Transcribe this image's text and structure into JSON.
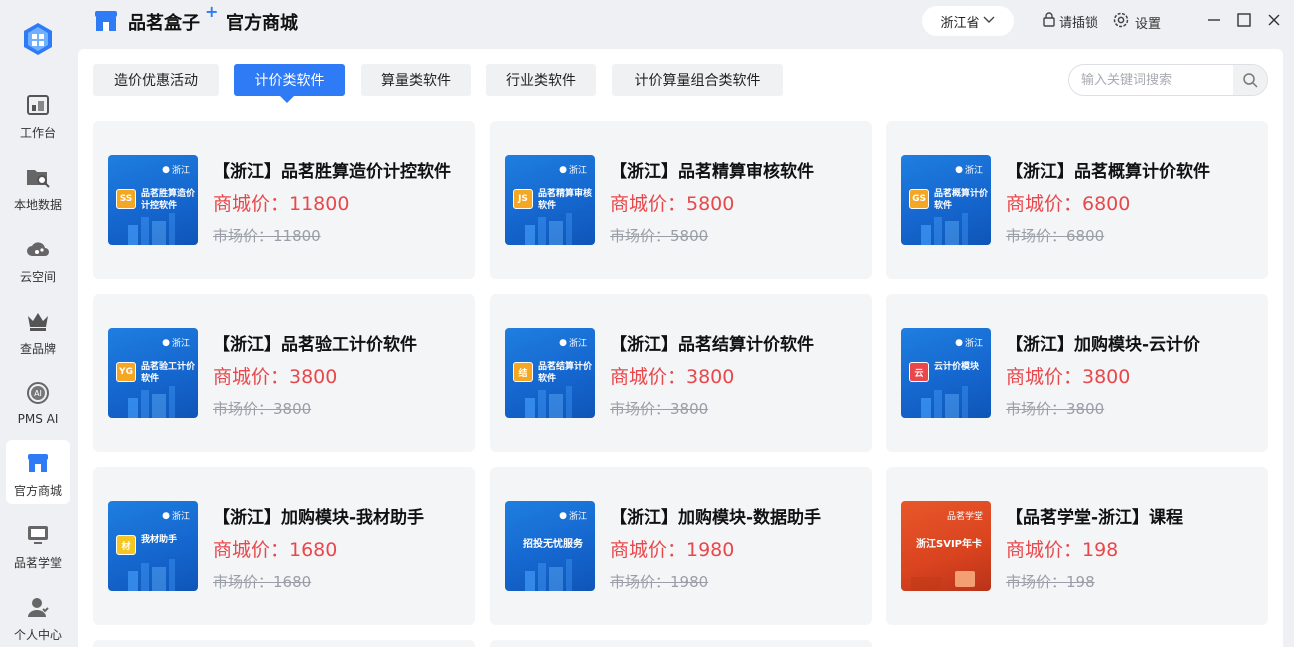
{
  "app": {
    "name": "品茗盒子",
    "plus": "+",
    "subtitle": "官方商城"
  },
  "header": {
    "province": "浙江省",
    "lock_label": "请插锁",
    "settings_label": "设置"
  },
  "sidebar": {
    "items": [
      {
        "label": "工作台"
      },
      {
        "label": "本地数据"
      },
      {
        "label": "云空间"
      },
      {
        "label": "查品牌"
      },
      {
        "label": "PMS AI"
      },
      {
        "label": "官方商城"
      },
      {
        "label": "品茗学堂"
      },
      {
        "label": "个人中心"
      }
    ]
  },
  "tabs": [
    {
      "label": "造价优惠活动"
    },
    {
      "label": "计价类软件"
    },
    {
      "label": "算量类软件"
    },
    {
      "label": "行业类软件"
    },
    {
      "label": "计价算量组合类软件"
    }
  ],
  "search": {
    "placeholder": "输入关键词搜索"
  },
  "products": [
    {
      "title": "【浙江】品茗胜算造价计控软件",
      "price": "商城价：11800",
      "market": "市场价：11800",
      "loc": "浙江",
      "badge": "SS",
      "thumb_name": "品茗胜算造价计控软件"
    },
    {
      "title": "【浙江】品茗精算审核软件",
      "price": "商城价：5800",
      "market": "市场价：5800",
      "loc": "浙江",
      "badge": "JS",
      "thumb_name": "品茗精算审核软件"
    },
    {
      "title": "【浙江】品茗概算计价软件",
      "price": "商城价：6800",
      "market": "市场价：6800",
      "loc": "浙江",
      "badge": "GS",
      "thumb_name": "品茗概算计价软件"
    },
    {
      "title": "【浙江】品茗验工计价软件",
      "price": "商城价：3800",
      "market": "市场价：3800",
      "loc": "浙江",
      "badge": "YG",
      "thumb_name": "品茗验工计价软件"
    },
    {
      "title": "【浙江】品茗结算计价软件",
      "price": "商城价：3800",
      "market": "市场价：3800",
      "loc": "浙江",
      "badge": "结",
      "thumb_name": "品茗结算计价软件"
    },
    {
      "title": "【浙江】加购模块-云计价",
      "price": "商城价：3800",
      "market": "市场价：3800",
      "loc": "浙江",
      "badge": "云",
      "thumb_name": "云计价模块"
    },
    {
      "title": "【浙江】加购模块-我材助手",
      "price": "商城价：1680",
      "market": "市场价：1680",
      "loc": "浙江",
      "badge": "材",
      "thumb_name": "我材助手"
    },
    {
      "title": "【浙江】加购模块-数据助手",
      "price": "商城价：1980",
      "market": "市场价：1980",
      "loc": "浙江",
      "badge": "",
      "thumb_name": "招投无忧服务"
    },
    {
      "title": "【品茗学堂-浙江】课程",
      "price": "商城价：198",
      "market": "市场价：198",
      "loc": "品茗学堂",
      "badge": "",
      "thumb_name": "浙江SVIP年卡"
    }
  ],
  "colors": {
    "accent": "#2f7bf5",
    "price": "#e8484b",
    "market": "#9a9ea6"
  }
}
